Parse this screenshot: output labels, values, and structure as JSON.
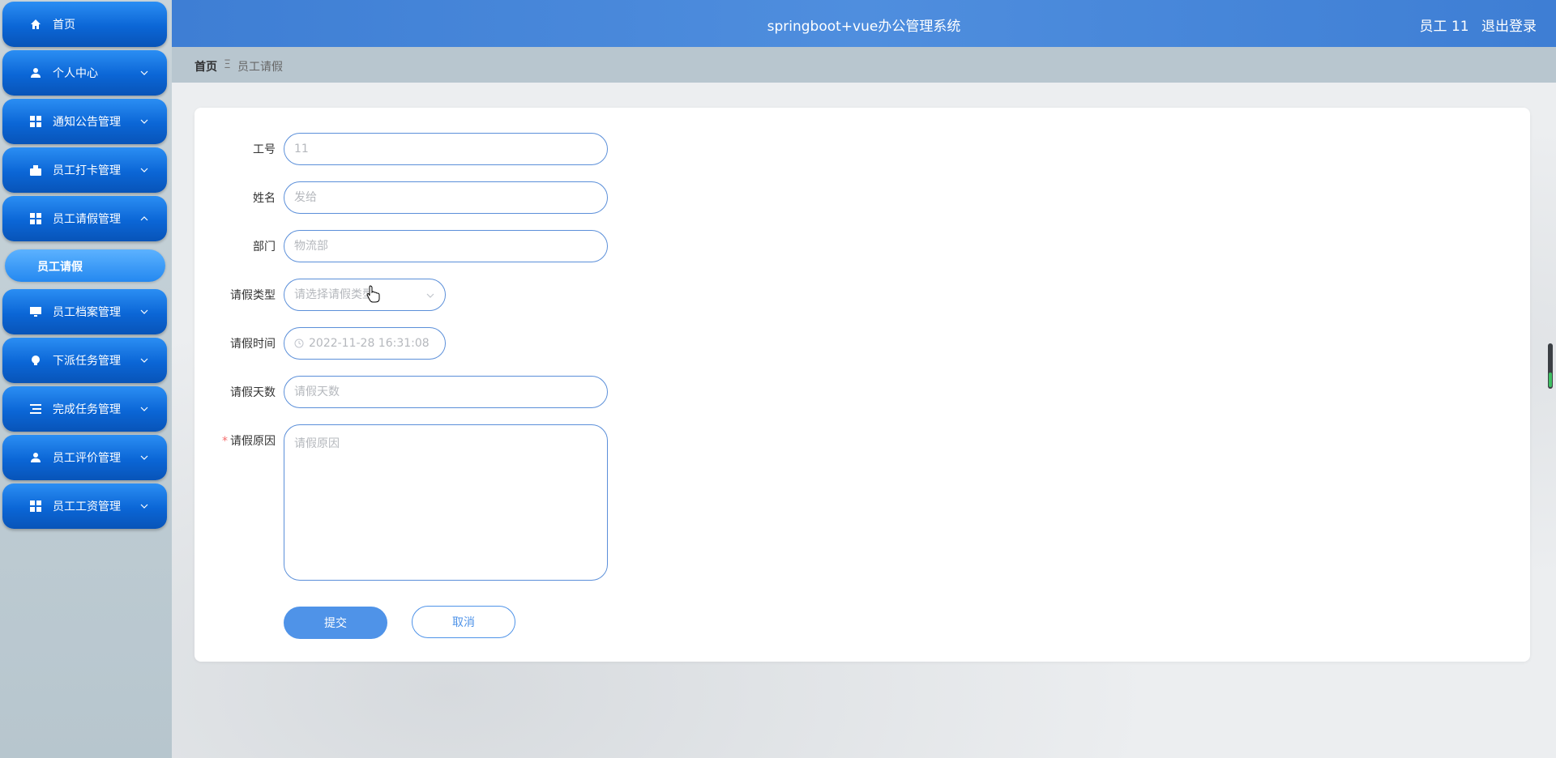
{
  "sidebar": {
    "items": [
      {
        "label": "首页",
        "icon": "home-icon",
        "has_arrow": false
      },
      {
        "label": "个人中心",
        "icon": "person-icon",
        "has_arrow": true
      },
      {
        "label": "通知公告管理",
        "icon": "grid-icon",
        "has_arrow": true
      },
      {
        "label": "员工打卡管理",
        "icon": "clock-in-icon",
        "has_arrow": true
      },
      {
        "label": "员工请假管理",
        "icon": "grid-icon",
        "has_arrow": true,
        "expanded": true
      },
      {
        "label": "员工档案管理",
        "icon": "monitor-icon",
        "has_arrow": true
      },
      {
        "label": "下派任务管理",
        "icon": "bulb-icon",
        "has_arrow": true
      },
      {
        "label": "完成任务管理",
        "icon": "list-icon",
        "has_arrow": true
      },
      {
        "label": "员工评价管理",
        "icon": "person-icon",
        "has_arrow": true
      },
      {
        "label": "员工工资管理",
        "icon": "grid-icon",
        "has_arrow": true
      }
    ],
    "active_sub": {
      "label": "员工请假"
    }
  },
  "header": {
    "title": "springboot+vue办公管理系统",
    "user": "员工 11",
    "logout": "退出登录"
  },
  "breadcrumb": {
    "home": "首页",
    "separator": "Ξ",
    "current": "员工请假"
  },
  "form": {
    "gonghao": {
      "label": "工号",
      "value": "11"
    },
    "xingming": {
      "label": "姓名",
      "value": "发给"
    },
    "bumen": {
      "label": "部门",
      "value": "物流部"
    },
    "leave_type": {
      "label": "请假类型",
      "placeholder": "请选择请假类型"
    },
    "leave_time": {
      "label": "请假时间",
      "value": "2022-11-28 16:31:08"
    },
    "leave_days": {
      "label": "请假天数",
      "placeholder": "请假天数"
    },
    "leave_reason": {
      "label": "请假原因",
      "placeholder": "请假原因",
      "required_mark": "*"
    },
    "submit": "提交",
    "cancel": "取消"
  },
  "colors": {
    "accent": "#4f93e8",
    "header": "#3e7ed4",
    "sidebar_item": "#0b66d6"
  }
}
